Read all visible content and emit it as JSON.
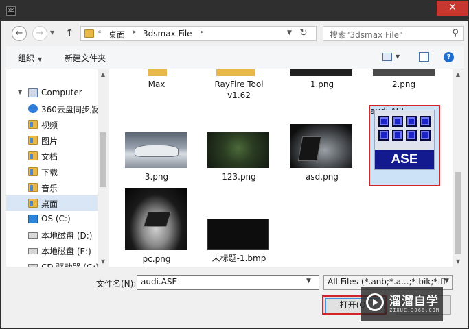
{
  "window": {
    "app_icon_text": "3DS",
    "close_glyph": "✕"
  },
  "nav": {
    "back_glyph": "←",
    "forward_glyph": "→",
    "up_glyph": "↑",
    "refresh_glyph": "↻",
    "breadcrumb": [
      "桌面",
      "3dsmax File"
    ],
    "search_placeholder": "搜索\"3dsmax File\""
  },
  "toolbar": {
    "organize_label": "组织",
    "new_folder_label": "新建文件夹",
    "help_glyph": "?"
  },
  "sidebar": {
    "items": [
      {
        "label": "Computer",
        "icon": "computer-icon"
      },
      {
        "label": "360云盘同步版",
        "icon": "cloud-icon"
      },
      {
        "label": "视频",
        "icon": "folder-icon"
      },
      {
        "label": "图片",
        "icon": "folder-icon"
      },
      {
        "label": "文档",
        "icon": "folder-icon"
      },
      {
        "label": "下载",
        "icon": "folder-icon"
      },
      {
        "label": "音乐",
        "icon": "folder-icon"
      },
      {
        "label": "桌面",
        "icon": "folder-icon",
        "selected": true
      },
      {
        "label": "OS (C:)",
        "icon": "os-drive-icon"
      },
      {
        "label": "本地磁盘 (D:)",
        "icon": "drive-icon"
      },
      {
        "label": "本地磁盘 (E:)",
        "icon": "drive-icon"
      },
      {
        "label": "CD 驱动器 (G:)",
        "icon": "cd-drive-icon"
      }
    ]
  },
  "files": {
    "row1": [
      {
        "label": "Max"
      },
      {
        "label": "RayFire Tool v1.62"
      },
      {
        "label": "1.png"
      },
      {
        "label": "2.png"
      }
    ],
    "row2": [
      {
        "label": "3.png"
      },
      {
        "label": "123.png"
      },
      {
        "label": "asd.png"
      },
      {
        "label": "audi.ASE",
        "selected": true,
        "thumb_text": "ASE"
      }
    ],
    "row3": [
      {
        "label": "pc.png"
      },
      {
        "label": "未标题-1.bmp"
      }
    ]
  },
  "bottom": {
    "filename_label": "文件名(N):",
    "filename_value": "audi.ASE",
    "filter_value": "All Files (*.anb;*.a...;*.bik;*.fl",
    "open_label": "打开(O)",
    "cancel_label": "取消"
  },
  "watermark": {
    "title": "溜溜自学",
    "subtitle": "ZIXUE.3D66.COM"
  },
  "colors": {
    "highlight_red": "#d0262b",
    "selection_blue": "#cce3f7",
    "close_red": "#c7372f"
  }
}
